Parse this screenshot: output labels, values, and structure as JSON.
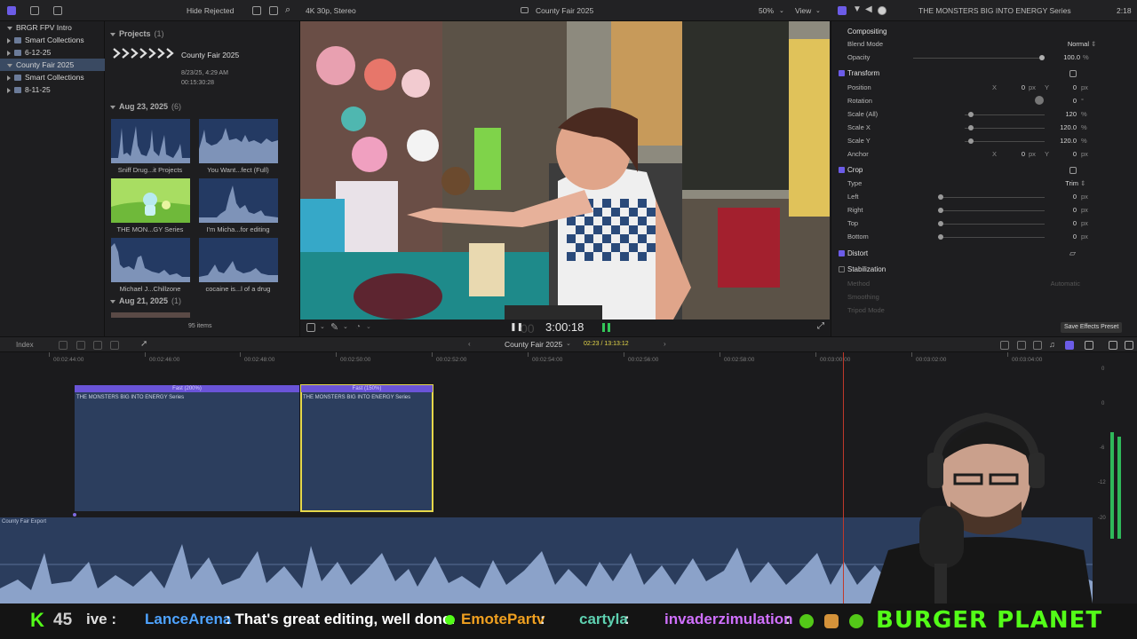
{
  "topbar": {
    "hide_rejected": "Hide Rejected",
    "format": "4K 30p, Stereo",
    "project_title": "County Fair 2025",
    "zoom": "50%",
    "view": "View",
    "inspector_clip": "THE MONSTERS BIG INTO ENERGY Series",
    "inspector_duration": "2:18"
  },
  "library": {
    "items": [
      {
        "label": "BRGR FPV Intro"
      },
      {
        "label": "Smart Collections"
      },
      {
        "label": "6-12-25"
      },
      {
        "label": "County Fair 2025"
      },
      {
        "label": "Smart Collections"
      },
      {
        "label": "8-11-25"
      }
    ]
  },
  "browser": {
    "projects_header": "Projects",
    "projects_count": "(1)",
    "project_name": "County Fair 2025",
    "project_date": "8/23/25, 4:29 AM",
    "project_duration": "00:15:30:28",
    "aug23_header": "Aug 23, 2025",
    "aug23_count": "(6)",
    "clips": [
      {
        "label": "Sniff Drug...it Projects"
      },
      {
        "label": "You Want...fect (Full)"
      },
      {
        "label": "THE MON...GY Series"
      },
      {
        "label": "I'm Micha...for editing"
      },
      {
        "label": "Michael J...Chillzone"
      },
      {
        "label": "cocaine is...l of a drug"
      }
    ],
    "aug21_header": "Aug 21, 2025",
    "aug21_count": "(1)",
    "item_count": "95 items"
  },
  "viewer": {
    "timecode": "3:00:18"
  },
  "inspector": {
    "compositing": "Compositing",
    "blend_mode_label": "Blend Mode",
    "blend_mode_value": "Normal",
    "opacity_label": "Opacity",
    "opacity_value": "100.0",
    "opacity_unit": "%",
    "transform": "Transform",
    "position_label": "Position",
    "x_label": "X",
    "y_label": "Y",
    "position_x": "0",
    "position_y": "0",
    "px": "px",
    "rotation_label": "Rotation",
    "rotation_value": "0",
    "deg": "°",
    "scale_all_label": "Scale (All)",
    "scale_all_value": "120",
    "scale_x_label": "Scale X",
    "scale_x_value": "120.0",
    "scale_y_label": "Scale Y",
    "scale_y_value": "120.0",
    "anchor_label": "Anchor",
    "anchor_x": "0",
    "anchor_y": "0",
    "crop": "Crop",
    "type_label": "Type",
    "type_value": "Trim",
    "left_label": "Left",
    "right_label": "Right",
    "top_label": "Top",
    "bottom_label": "Bottom",
    "crop_value": "0",
    "distort": "Distort",
    "stabilization": "Stabilization",
    "method_label": "Method",
    "method_value": "Automatic",
    "smoothing_label": "Smoothing",
    "tripod_label": "Tripod Mode",
    "save_preset": "Save Effects Preset"
  },
  "timeline_bar": {
    "index": "Index",
    "project": "County Fair 2025",
    "position": "02:23 / 13:13:12"
  },
  "timeline": {
    "ticks": [
      "00:02:44:00",
      "00:02:46:00",
      "00:02:48:00",
      "00:02:50:00",
      "00:02:52:00",
      "00:02:54:00",
      "00:02:56:00",
      "00:02:58:00",
      "00:03:00:00",
      "00:03:02:00",
      "00:03:04:00"
    ],
    "clip1_speed": "Fast (200%)",
    "clip1_name": "THE MONSTERS BIG INTO ENERGY Series",
    "clip2_speed": "Fast (150%)",
    "clip2_name": "THE MONSTERS BIG INTO ENERGY Series",
    "audio_name": "County Fair Export",
    "meter_labels": [
      "0",
      "0",
      "-6",
      "-12",
      "-20"
    ]
  },
  "chat": {
    "count": "45",
    "frag": "ive :",
    "user1": "LanceArena",
    "msg1": ": That's great editing, well done.",
    "user2": "EmotePartv",
    "user3": "cartyla",
    "user4": "invaderzimulation",
    "brand": "BURGER PLANET"
  },
  "colors": {
    "accent": "#6c5ce7",
    "selection": "#e6d84a",
    "clip_blue": "#2c3e5e",
    "playhead": "#c0392b"
  }
}
